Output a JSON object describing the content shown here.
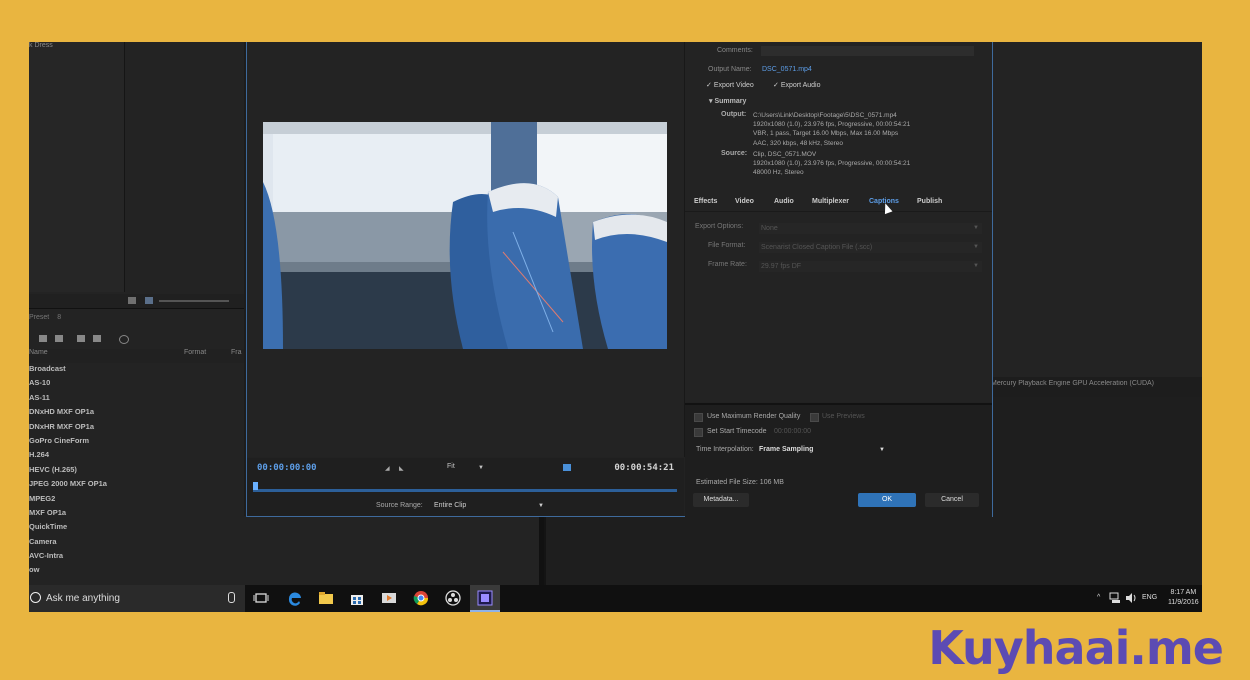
{
  "background_panels": {
    "top_left_label": "k Dress",
    "gpu_status": "Mercury Playback Engine GPU Acceleration (CUDA)",
    "presets_header": "Preset",
    "presets_count": "8",
    "columns": {
      "name": "Name",
      "format": "Format",
      "frame": "Fra"
    },
    "preset_items": [
      "Broadcast",
      "AS-10",
      "AS-11",
      "DNxHD MXF OP1a",
      "DNxHR MXF OP1a",
      "GoPro CineForm",
      "H.264",
      "HEVC (H.265)",
      "JPEG 2000 MXF OP1a",
      "MPEG2",
      "MXF OP1a",
      "QuickTime",
      "Camera",
      "AVC-Intra",
      "ow"
    ]
  },
  "preview": {
    "timecode_current": "00:00:00:00",
    "timecode_end": "00:00:54:21",
    "zoom": "Fit",
    "source_range_label": "Source Range:",
    "source_range_value": "Entire Clip"
  },
  "settings": {
    "comments_label": "Comments:",
    "output_name_label": "Output Name:",
    "output_name_value": "DSC_0571.mp4",
    "export_video": "Export Video",
    "export_audio": "Export Audio",
    "summary_label": "Summary",
    "output_key": "Output:",
    "output_lines": [
      "C:\\Users\\Link\\Desktop\\Footage\\5\\DSC_0571.mp4",
      "1920x1080 (1.0), 23.976 fps, Progressive, 00:00:54:21",
      "VBR, 1 pass, Target 16.00 Mbps, Max 16.00 Mbps",
      "AAC, 320 kbps, 48 kHz, Stereo"
    ],
    "source_key": "Source:",
    "source_lines": [
      "Clip, DSC_0571.MOV",
      "1920x1080 (1.0), 23.976 fps, Progressive, 00:00:54:21",
      "48000 Hz, Stereo"
    ],
    "tabs": [
      "Effects",
      "Video",
      "Audio",
      "Multiplexer",
      "Captions",
      "Publish"
    ],
    "active_tab": "Captions",
    "export_options_label": "Export Options:",
    "export_options_value": "None",
    "file_format_label": "File Format:",
    "file_format_value": "Scenarist Closed Caption File (.scc)",
    "frame_rate_label": "Frame Rate:",
    "frame_rate_value": "29.97 fps DF"
  },
  "footer": {
    "max_render_quality": "Use Maximum Render Quality",
    "use_previews": "Use Previews",
    "set_start_timecode": "Set Start Timecode",
    "start_timecode_value": "00:00:00:00",
    "time_interpolation_label": "Time Interpolation:",
    "time_interpolation_value": "Frame Sampling",
    "estimated_size": "Estimated File Size: 106 MB",
    "metadata_button": "Metadata...",
    "ok_button": "OK",
    "cancel_button": "Cancel"
  },
  "taskbar": {
    "search_placeholder": "Ask me anything",
    "language": "ENG",
    "time": "8:17 AM",
    "date": "11/9/2016"
  },
  "watermark": "Kuyhaai.me",
  "colors": {
    "background": "#e9b540",
    "accent_blue": "#5d9ee8",
    "ok_button": "#2f73b8",
    "watermark": "#5c4bb3"
  }
}
